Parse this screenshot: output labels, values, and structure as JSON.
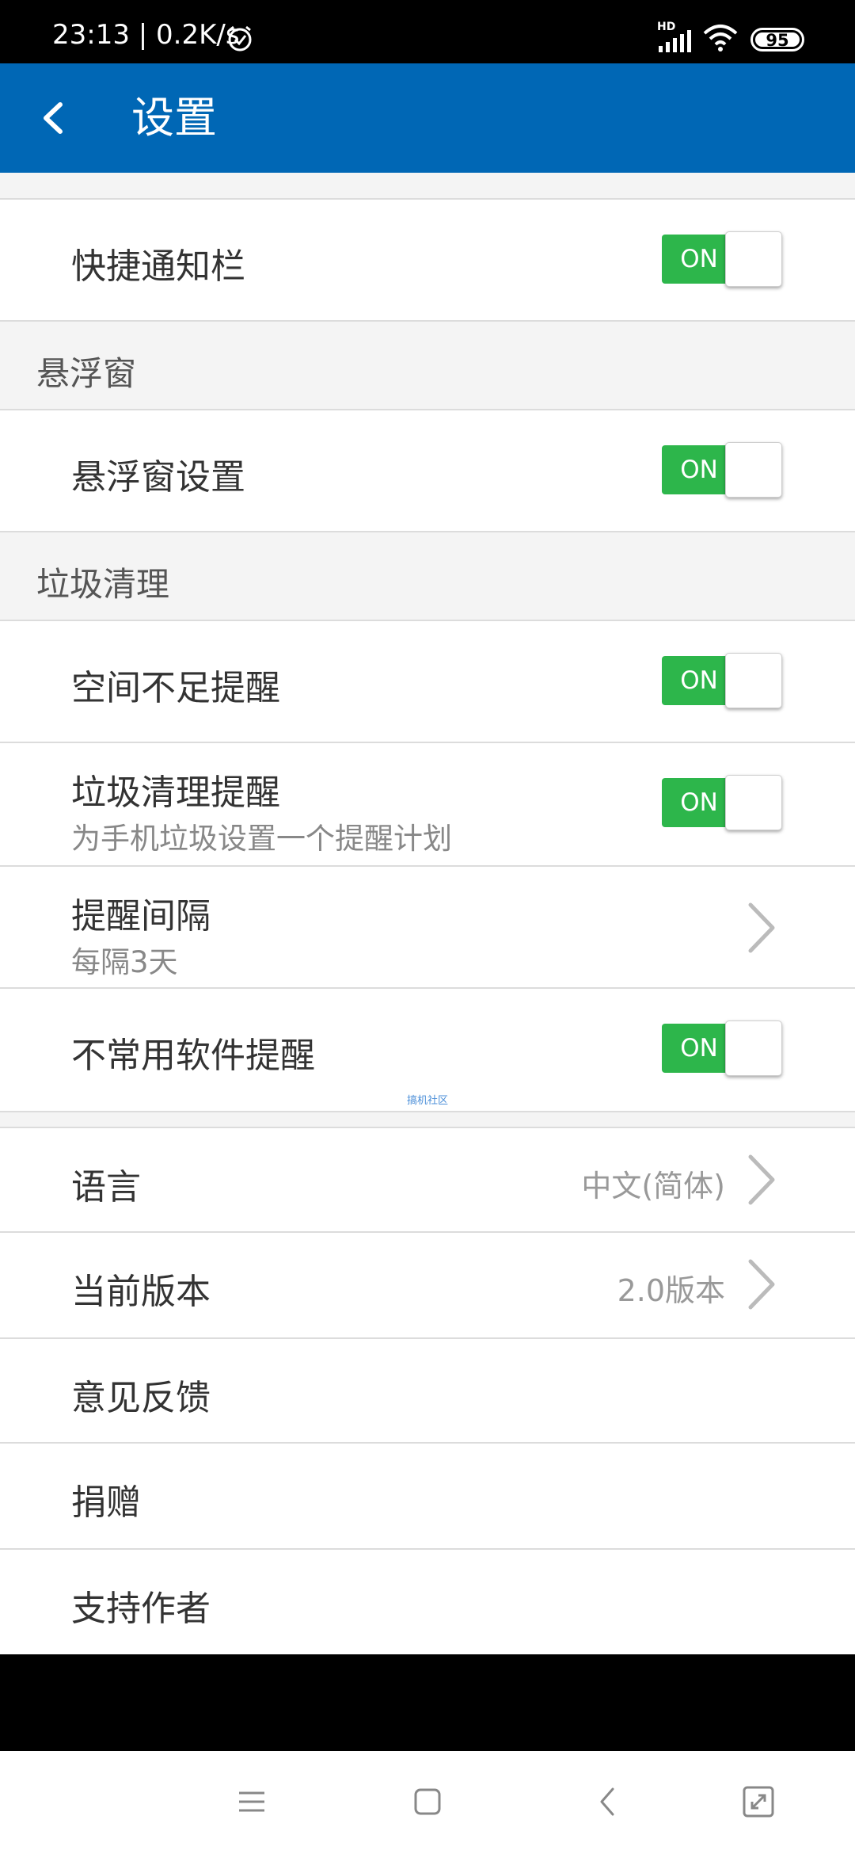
{
  "status_bar": {
    "time_speed": "23:13 | 0.2K/s",
    "network_badge": "HD",
    "battery": "95",
    "icons": [
      "alarm-icon",
      "hd-signal-icon",
      "wifi-icon",
      "battery-icon"
    ]
  },
  "app_bar": {
    "title": "设置",
    "back_icon": "back-arrow-icon",
    "color": "#0067b5"
  },
  "rows": {
    "quick_notification": {
      "label": "快捷通知栏",
      "toggle": "ON"
    },
    "floating_settings": {
      "label": "悬浮窗设置",
      "toggle": "ON"
    },
    "low_space_reminder": {
      "label": "空间不足提醒",
      "toggle": "ON"
    },
    "junk_reminder": {
      "label": "垃圾清理提醒",
      "subtitle": "为手机垃圾设置一个提醒计划",
      "toggle": "ON"
    },
    "reminder_interval": {
      "label": "提醒间隔",
      "subtitle": "每隔3天"
    },
    "unused_app_reminder": {
      "label": "不常用软件提醒",
      "toggle": "ON"
    },
    "language": {
      "label": "语言",
      "value": "中文(简体)"
    },
    "version": {
      "label": "当前版本",
      "value": "2.0版本"
    },
    "feedback": {
      "label": "意见反馈"
    },
    "donate": {
      "label": "捐赠"
    },
    "support_author": {
      "label": "支持作者"
    }
  },
  "sections": {
    "floating_window": "悬浮窗",
    "junk_cleanup": "垃圾清理"
  },
  "watermark": "搞机社区",
  "toggle_color": "#2db64b",
  "nav_bar": {
    "icons": [
      "menu-icon",
      "home-icon",
      "back-icon",
      "screenshot-icon"
    ]
  }
}
